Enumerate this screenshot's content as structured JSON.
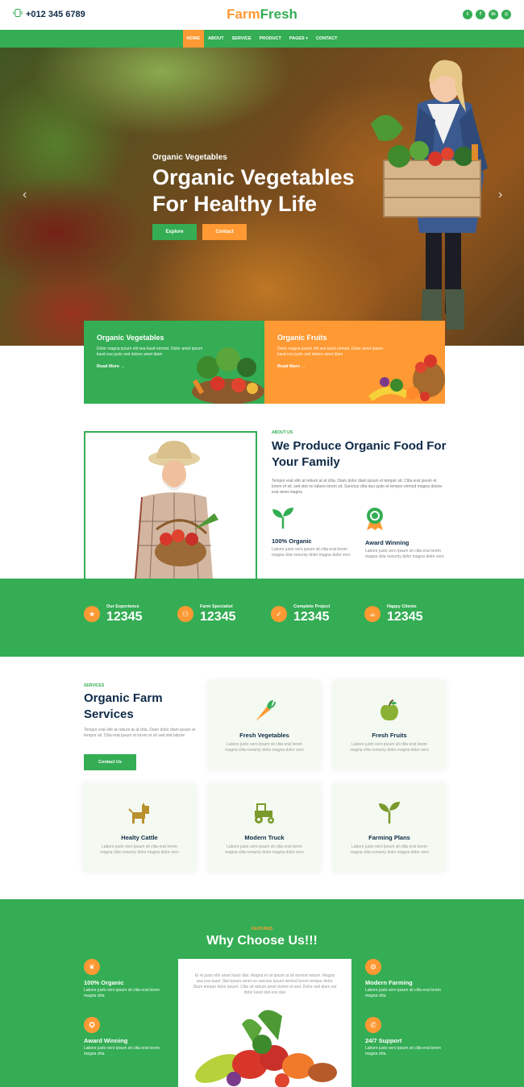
{
  "topbar": {
    "phone": "+012 345 6789",
    "logo_part1": "Farm",
    "logo_part2": "Fresh",
    "socials": [
      "twitter-icon",
      "facebook-icon",
      "linkedin-icon",
      "instagram-icon"
    ]
  },
  "nav": {
    "items": [
      "Home",
      "About",
      "Service",
      "Product",
      "Pages ▾",
      "Contact"
    ],
    "active": "Home"
  },
  "hero": {
    "subtitle": "Organic Vegetables",
    "title": "Organic Vegetables For Healthy Life",
    "explore_label": "Explore",
    "contact_label": "Contact",
    "prev_icon": "‹",
    "next_icon": "›"
  },
  "features": [
    {
      "title": "Organic Vegetables",
      "text": "Dolor magna ipsum elit sea kasd eirmod. Dolor amet ipsum kasd eos justo sed dolore amet diam",
      "link": "Read More →"
    },
    {
      "title": "Organic Fruits",
      "text": "Dolor magna ipsum elit sea kasd eirmod. Dolor amet ipsum kasd eos justo sed dolore amet diam",
      "link": "Read More →"
    }
  ],
  "about": {
    "tag": "About Us",
    "title": "We Produce Organic Food For Your Family",
    "text": "Tempor erat elitr at rebum at at clita. Diam dolor diam ipsum et tempor sit. Clita erat ipsum et lorem et sit, sed stet no labore lorem sit. Sanctus clita duo justo et tempor eirmod magna dolore erat amet magna",
    "features": [
      {
        "title": "100% Organic",
        "text": "Labore justo vero ipsum sit clita erat lorem magna clita nonumy dolor magna dolor vero"
      },
      {
        "title": "Award Winning",
        "text": "Labore justo vero ipsum sit clita erat lorem magna clita nonumy dolor magna dolor vero"
      }
    ]
  },
  "stats": [
    {
      "label": "Our Experience",
      "value": "12345",
      "icon": "star-icon"
    },
    {
      "label": "Farm Specialist",
      "value": "12345",
      "icon": "users-icon"
    },
    {
      "label": "Complete Project",
      "value": "12345",
      "icon": "check-icon"
    },
    {
      "label": "Happy Clients",
      "value": "12345",
      "icon": "mug-icon"
    }
  ],
  "services": {
    "tag": "Services",
    "title": "Organic Farm Services",
    "text": "Tempor erat elitr at rebum at at clita. Diam dolor diam ipsum et tempor sit. Clita erat ipsum et lorem et sit sed stet labore",
    "button": "Contact Us",
    "cards": [
      {
        "title": "Fresh Vegetables",
        "text": "Labore justo vero ipsum sit clita erat lorem magna clita nonumy dolor magna dolor vero"
      },
      {
        "title": "Fresh Fruits",
        "text": "Labore justo vero ipsum sit clita erat lorem magna clita nonumy dolor magna dolor vero"
      },
      {
        "title": "Healty Cattle",
        "text": "Labore justo vero ipsum sit clita erat lorem magna clita nonumy dolor magna dolor vero"
      },
      {
        "title": "Modern Truck",
        "text": "Labore justo vero ipsum sit clita erat lorem magna clita nonumy dolor magna dolor vero"
      },
      {
        "title": "Farming Plans",
        "text": "Labore justo vero ipsum sit clita erat lorem magna clita nonumy dolor magna dolor vero"
      }
    ]
  },
  "why": {
    "tag": "Features",
    "title": "Why Choose Us!!!",
    "center_text": "Et et justo elitr amet kasd clita. Magna et sit ipsum ut sit eirmod rebum. Magna sea eos kasd. Stet ipsum amet no sanctus ipsum eirmod lorem tempor dolor. Diam tempor dolor ipsum. Clita sit rebum amet dolore et sed. Dolor sed diam est dolor kasd stet eos duo",
    "items": [
      {
        "title": "100% Organic",
        "text": "Labore justo vero ipsum sit clita erat lorem magna clita"
      },
      {
        "title": "Award Winning",
        "text": "Labore justo vero ipsum sit clita erat lorem magna clita"
      },
      {
        "title": "Modern Farming",
        "text": "Labore justo vero ipsum sit clita erat lorem magna clita"
      },
      {
        "title": "24/7 Support",
        "text": "Labore justo vero ipsum sit clita erat lorem magna clita"
      }
    ]
  },
  "colors": {
    "green": "#34ad54",
    "orange": "#ff9933",
    "navy": "#0e2a47"
  }
}
